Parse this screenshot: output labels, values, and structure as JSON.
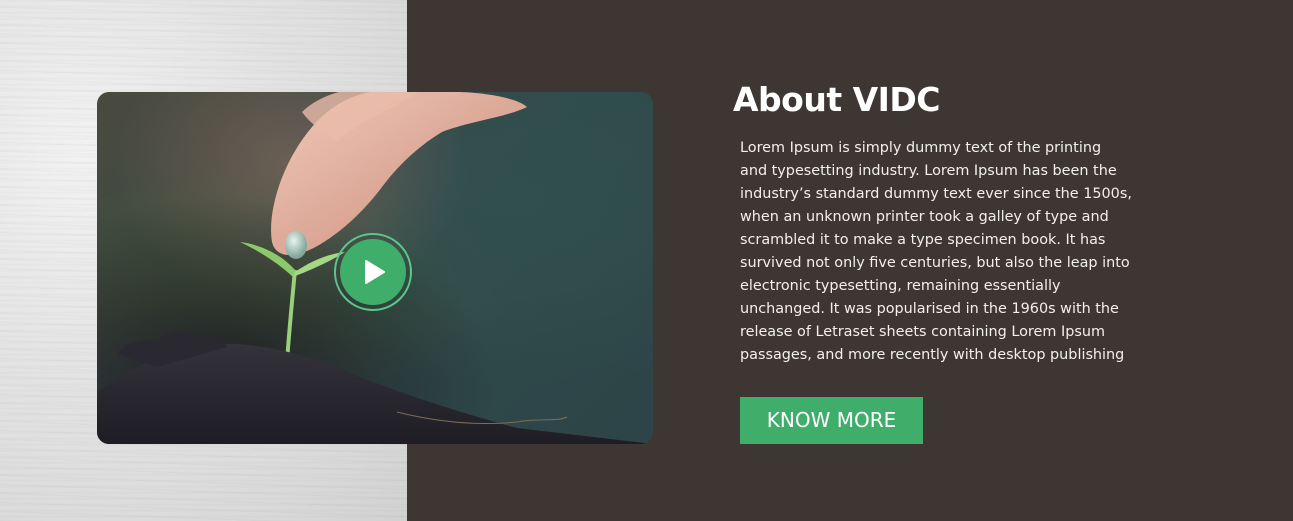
{
  "about": {
    "title": "About VIDC",
    "description": "Lorem Ipsum is simply dummy text of the printing and typesetting industry. Lorem Ipsum has been the industry’s standard dummy text ever since the 1500s, when an unknown printer took a galley of type and scrambled it to make a type specimen book. It has survived not only five centuries, but also the leap into electronic typesetting, remaining essentially unchanged. It was popularised in the 1960s with the release of Letraset sheets containing Lorem Ipsum passages, and more recently with desktop publishing",
    "cta_label": "KNOW MORE"
  },
  "video": {
    "image_subject": "hand-watering-seedling",
    "play_icon": "play-icon"
  },
  "colors": {
    "accent": "#3fae6a",
    "accent_ring": "#5cc78a",
    "panel_background": "#3e3632",
    "texture_background": "#e2e2e2",
    "text": "#ffffff"
  }
}
